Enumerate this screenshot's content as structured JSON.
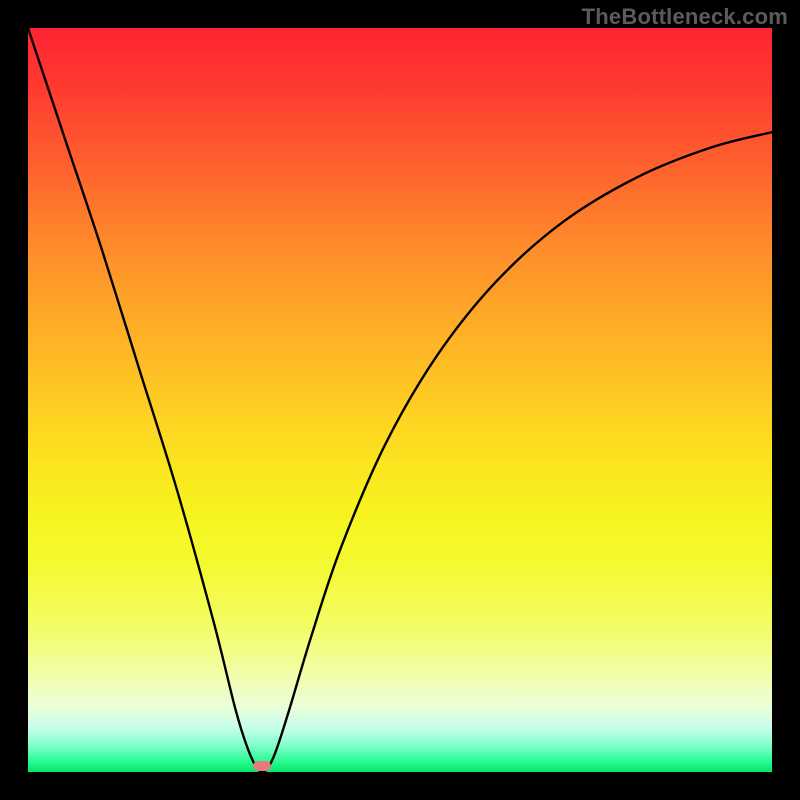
{
  "watermark": "TheBottleneck.com",
  "chart_data": {
    "type": "line",
    "title": "",
    "xlabel": "",
    "ylabel": "",
    "xlim": [
      0,
      100
    ],
    "ylim": [
      0,
      100
    ],
    "grid": false,
    "series": [
      {
        "name": "bottleneck-curve",
        "x": [
          0,
          5,
          10,
          15,
          20,
          25,
          28,
          30,
          31.5,
          33,
          35,
          38,
          42,
          48,
          55,
          63,
          72,
          82,
          92,
          100
        ],
        "y": [
          100,
          85,
          70,
          54,
          38,
          20,
          8,
          2,
          0,
          2,
          8,
          18,
          30,
          44,
          56,
          66,
          74,
          80,
          84,
          86
        ]
      }
    ],
    "annotations": [
      {
        "name": "optimal-marker",
        "x": 31.5,
        "y": 0.8
      }
    ],
    "background_gradient": {
      "top": "#fe2433",
      "middle": "#fae81f",
      "bottom": "#05e66b"
    }
  }
}
